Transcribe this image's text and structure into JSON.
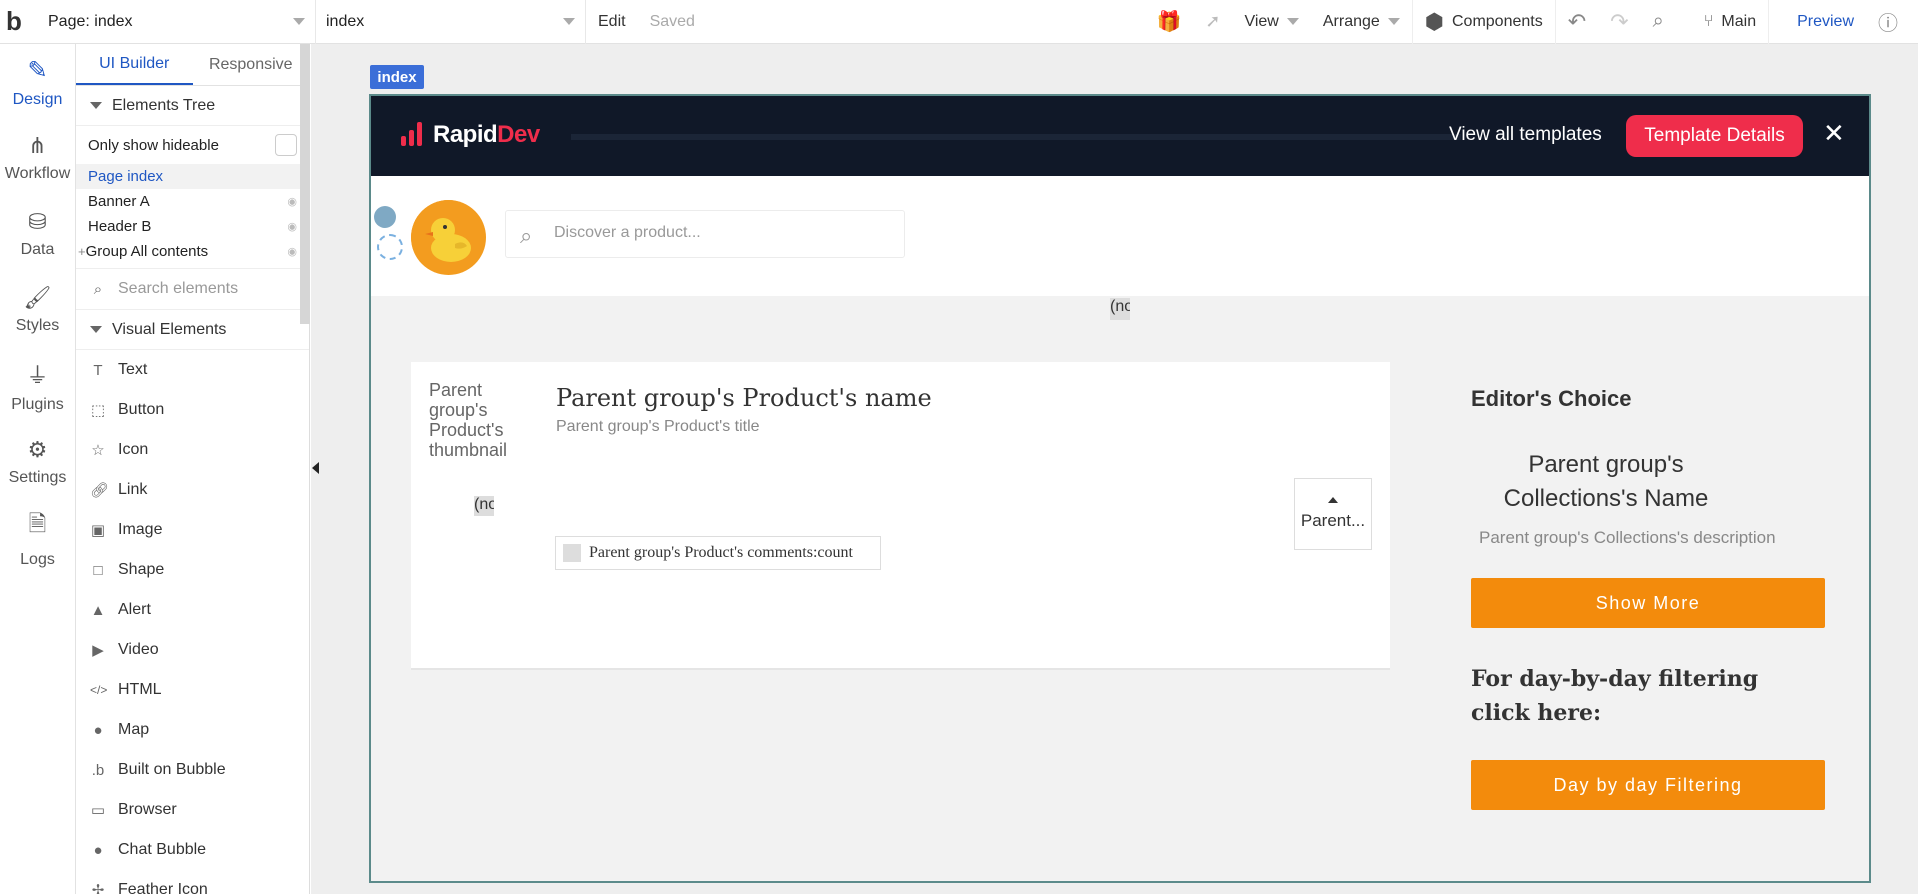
{
  "topbar": {
    "logo": "b",
    "page_selector": "Page: index",
    "element_selector": "index",
    "edit": "Edit",
    "saved": "Saved",
    "view": "View",
    "arrange": "Arrange",
    "components": "Components",
    "branch": "Main",
    "preview": "Preview"
  },
  "nav": [
    {
      "label": "Design",
      "icon": "pen-ruler-icon"
    },
    {
      "label": "Workflow",
      "icon": "hierarchy-icon"
    },
    {
      "label": "Data",
      "icon": "database-icon"
    },
    {
      "label": "Styles",
      "icon": "brush-icon"
    },
    {
      "label": "Plugins",
      "icon": "plug-icon"
    },
    {
      "label": "Settings",
      "icon": "gear-icon"
    },
    {
      "label": "Logs",
      "icon": "document-icon"
    }
  ],
  "panel": {
    "tabs": [
      "UI Builder",
      "Responsive"
    ],
    "elements_tree": "Elements Tree",
    "only_hideable": "Only show hideable",
    "tree": [
      "Page index",
      "Banner A",
      "Header B",
      "Group All contents"
    ],
    "search_placeholder": "Search elements",
    "visual_elements": "Visual Elements",
    "elements": [
      "Text",
      "Button",
      "Icon",
      "Link",
      "Image",
      "Shape",
      "Alert",
      "Video",
      "HTML",
      "Map",
      "Built on Bubble",
      "Browser",
      "Chat Bubble",
      "Feather Icon"
    ]
  },
  "canvas": {
    "page_tag": "index",
    "banner": {
      "brand_a": "Rapid",
      "brand_b": "Dev",
      "view_all": "View all templates",
      "details": "Template Details",
      "close": "✕"
    },
    "header": {
      "search_placeholder": "Discover a product..."
    },
    "ne_text": "(no",
    "card": {
      "thumbnail": "Parent group's Product's thumbnail",
      "name": "Parent group's Product's name",
      "title": "Parent group's Product's title",
      "comments": "Parent group's Product's comments:count",
      "upvote": "Parent..."
    },
    "side": {
      "editor": "Editor's Choice",
      "collection_name": "Parent group's Collections's Name",
      "collection_desc": "Parent group's Collections's description",
      "show_more": "Show More",
      "filter_text": "For day-by-day filtering click here:",
      "filter_btn": "Day by day Filtering"
    }
  }
}
